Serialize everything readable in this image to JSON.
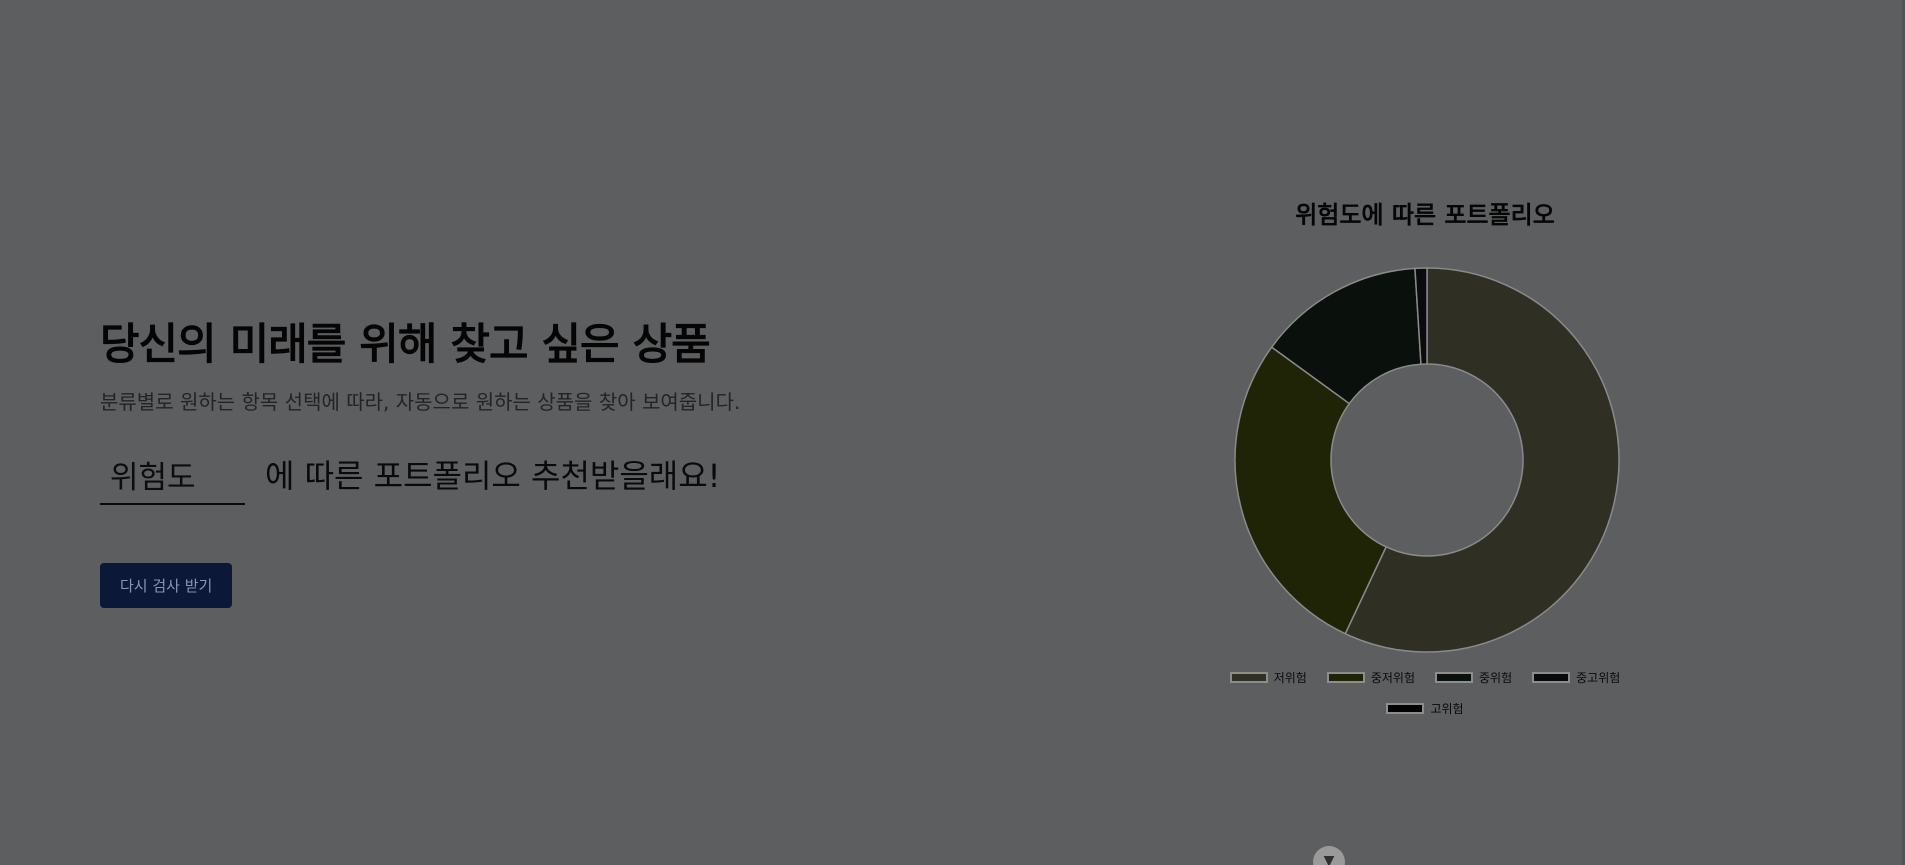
{
  "hero": {
    "headline": "당신의 미래를 위해 찾고 싶은 상품",
    "subline": "분류별로 원하는 항목 선택에 따라, 자동으로 원하는 상품을 찾아 보여줍니다.",
    "selector_value": "위험도",
    "selector_suffix": "에 따른 포트폴리오 추천받을래요!",
    "retry_label": "다시 검사 받기"
  },
  "scroll_icon": "chevron-down-icon",
  "chart_data": {
    "type": "pie",
    "title": "위험도에 따른 포트폴리오",
    "categories": [
      "저위험",
      "중저위험",
      "중위험",
      "중고위험",
      "고위험"
    ],
    "values": [
      57,
      28,
      14,
      1,
      0
    ],
    "colors": [
      "#2f2f24",
      "#1e2405",
      "#0a100b",
      "#090b0c",
      "#030303"
    ],
    "legend_position": "bottom"
  }
}
